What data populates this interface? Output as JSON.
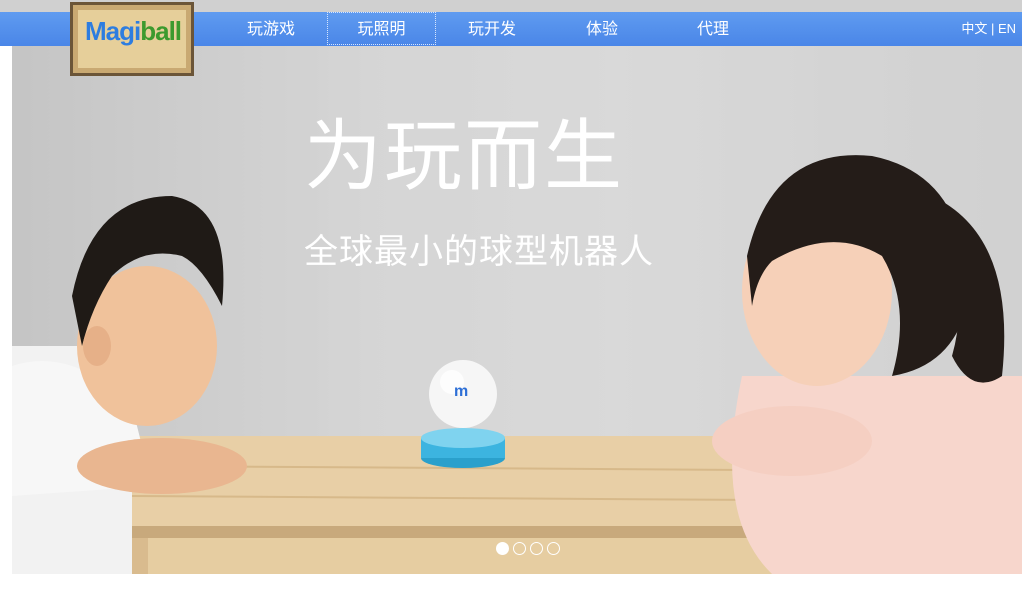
{
  "logo": {
    "text_a": "Magi",
    "text_b": "ball"
  },
  "nav": {
    "items": [
      {
        "label": "玩游戏"
      },
      {
        "label": "玩照明"
      },
      {
        "label": "玩开发"
      },
      {
        "label": "体验"
      },
      {
        "label": "代理"
      }
    ],
    "active_index": 1
  },
  "lang": {
    "zh": "中文",
    "sep": " | ",
    "en": "EN"
  },
  "hero": {
    "title": "为玩而生",
    "subtitle": "全球最小的球型机器人"
  },
  "carousel": {
    "slides": 4,
    "current": 1
  },
  "colors": {
    "nav": "#4a86e8",
    "device_cyan": "#3cb4e0",
    "logo_brown": "#6b5538"
  }
}
